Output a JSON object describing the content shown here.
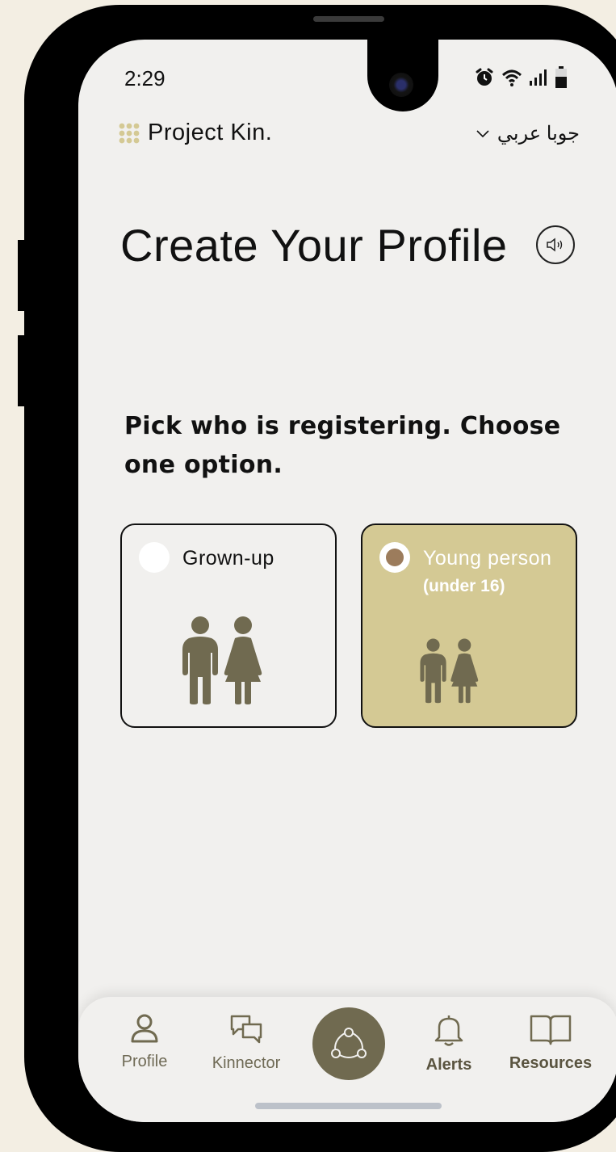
{
  "status_bar": {
    "time": "2:29"
  },
  "header": {
    "app_name": "Project Kin.",
    "language": "جوبا عربي"
  },
  "page": {
    "title": "Create Your Profile",
    "question": "Pick who is registering. Choose one option."
  },
  "options": [
    {
      "label": "Grown-up",
      "sublabel": "",
      "selected": false
    },
    {
      "label": "Young person",
      "sublabel": "(under 16)",
      "selected": true
    }
  ],
  "nav": {
    "items": [
      {
        "label": "Profile",
        "icon": "person-icon"
      },
      {
        "label": "Kinnector",
        "icon": "chat-bubbles-icon"
      },
      {
        "label": "",
        "icon": "network-icon"
      },
      {
        "label": "Alerts",
        "icon": "bell-icon"
      },
      {
        "label": "Resources",
        "icon": "book-icon"
      }
    ]
  },
  "colors": {
    "accent": "#d4c994",
    "nav_center": "#706a50",
    "figure": "#706a50",
    "logo": "#d4c994"
  }
}
